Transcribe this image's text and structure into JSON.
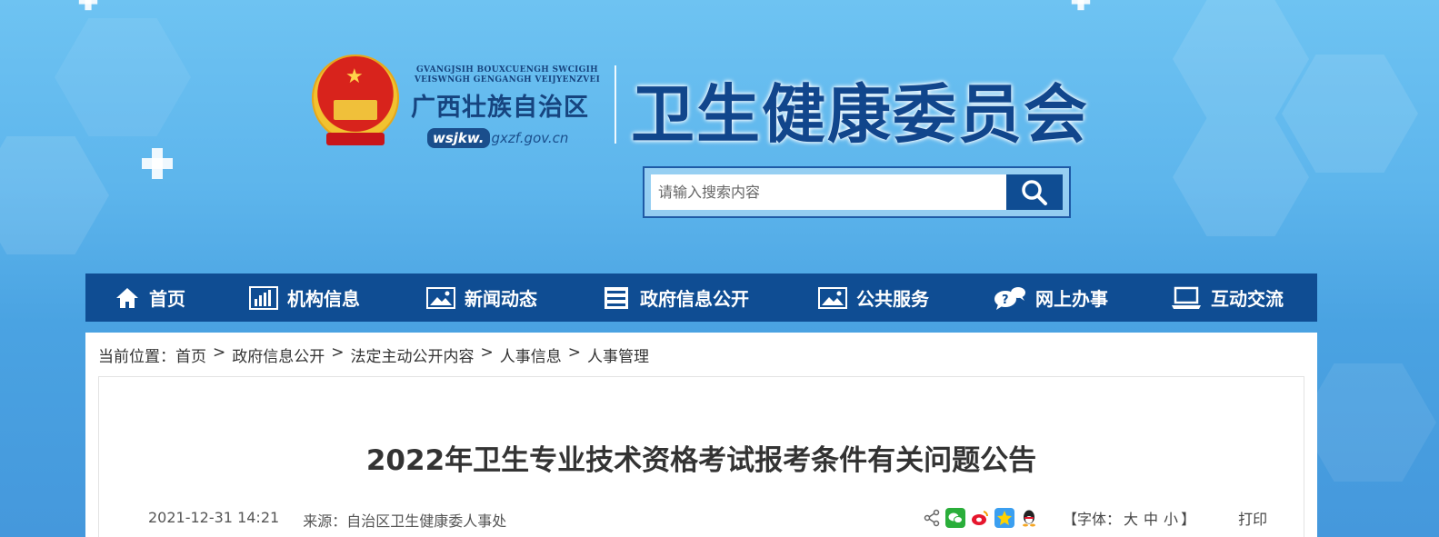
{
  "header": {
    "region_latin_line1": "GVANGJSIH BOUXCUENGH SWCIGIH",
    "region_latin_line2": "VEISWNGH GENGANGH VEIJYENZVEI",
    "region_name": "广西壮族自治区",
    "domain_prefix": "wsjkw.",
    "domain_rest": "gxzf.gov.cn",
    "org_title": "卫生健康委员会"
  },
  "search": {
    "placeholder": "请输入搜索内容"
  },
  "nav": {
    "items": [
      {
        "label": "首页",
        "icon": "home-icon"
      },
      {
        "label": "机构信息",
        "icon": "bar-chart-icon"
      },
      {
        "label": "新闻动态",
        "icon": "picture-icon"
      },
      {
        "label": "政府信息公开",
        "icon": "cabinet-icon"
      },
      {
        "label": "公共服务",
        "icon": "picture-icon"
      },
      {
        "label": "网上办事",
        "icon": "chat-icon"
      },
      {
        "label": "互动交流",
        "icon": "laptop-icon"
      }
    ]
  },
  "breadcrumb": {
    "prefix": "当前位置：",
    "items": [
      "首页",
      "政府信息公开",
      "法定主动公开内容",
      "人事信息",
      "人事管理"
    ],
    "separator": ">"
  },
  "article": {
    "title": "2022年卫生专业技术资格考试报考条件有关问题公告",
    "date": "2021-12-31 14:21",
    "source": "来源：自治区卫生健康委人事处",
    "font_size_label_open": "【字体：",
    "font_large": "大",
    "font_medium": "中",
    "font_small": "小",
    "font_size_label_close": "】",
    "print_label": "打印"
  },
  "colors": {
    "nav_bg": "#0f4d93",
    "title_blue": "#11468c"
  }
}
